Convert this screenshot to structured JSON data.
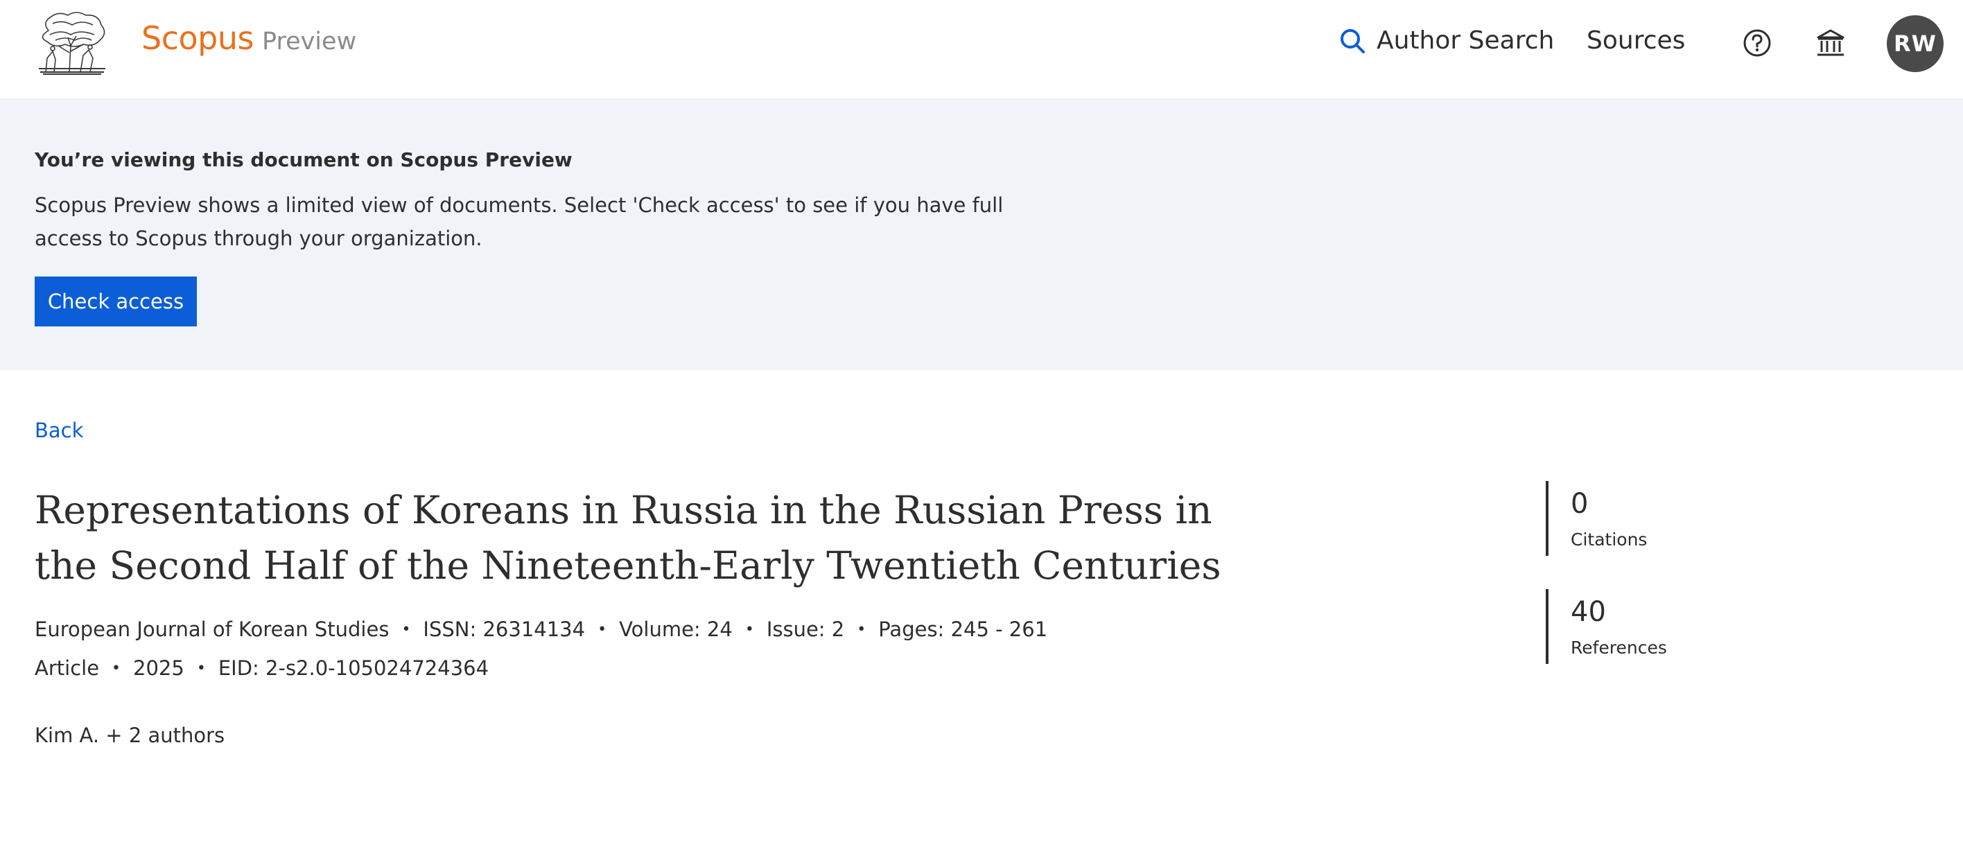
{
  "header": {
    "brand_name": "Scopus",
    "brand_suffix": "Preview",
    "nav": {
      "author_search": "Author Search",
      "sources": "Sources"
    },
    "avatar_initials": "RW"
  },
  "banner": {
    "title": "You’re viewing this document on Scopus Preview",
    "text": "Scopus Preview shows a limited view of documents. Select 'Check access' to see if you have full access to Scopus through your organization.",
    "button_label": "Check access"
  },
  "document": {
    "back_label": "Back",
    "title": "Representations of Koreans in Russia in the Russian Press in the Second Half of the Nineteenth-Early Twentieth Centuries",
    "journal": "European Journal of Korean Studies",
    "issn": "ISSN: 26314134",
    "volume": "Volume: 24",
    "issue": "Issue: 2",
    "pages": "Pages: 245 - 261",
    "type": "Article",
    "year": "2025",
    "eid": "EID: 2-s2.0-105024724364",
    "authors": "Kim A. + 2 authors",
    "separator": "•"
  },
  "metrics": {
    "citations_value": "0",
    "citations_label": "Citations",
    "references_value": "40",
    "references_label": "References"
  },
  "colors": {
    "brand_orange": "#e9711c",
    "link_blue": "#0b5ed7",
    "banner_bg": "#f0f4f8",
    "avatar_bg": "#4a4a4a"
  },
  "icons": [
    "elsevier-tree-logo",
    "search-icon",
    "help-icon",
    "institution-icon"
  ]
}
